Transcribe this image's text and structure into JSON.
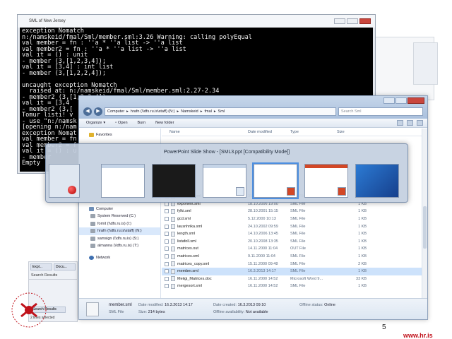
{
  "background_windows": {
    "editor_side_panel": {
      "tabs": [
        "Expl...",
        "Docu..."
      ],
      "panel_label": "Search Results",
      "bottom_tab": "Search Results",
      "status": "2 lines selected"
    }
  },
  "sml_window": {
    "title": "SML of New Jersey",
    "console_lines": [
      "exception Nomatch",
      "n:/namskeid/fmal/Sml/member.sml:3.26 Warning: calling polyEqual",
      "val member = fn : ''a * ''a list -> ''a list",
      "val member2 = fn : ''a * ''a list -> ''a list",
      "val it = () : unit",
      "- member (3,[1,2,3,4]);",
      "val it = [3,4] : int list",
      "- member (3,[1,2,2,4]);",
      "",
      "uncaught exception Nomatch",
      "  raised at: n:/namskeid/fmal/Sml/member.sml:2.27-2.34",
      "- member2 (3,[1,2,3,4]);",
      "val it = [3,4",
      "- member2 (3,[",
      "Tomur listi! v",
      "- use \"n:/namsk",
      "[opening n:/nam",
      "exception Nomat",
      "val member = fn",
      "val member2 = f",
      "val it = () : u",
      "- member",
      "Empty"
    ]
  },
  "explorer": {
    "address_path": [
      "Computer",
      "hrafn (\\\\dfs.ru.is\\staff) (N:)",
      "Namskeid",
      "fmal",
      "Sml"
    ],
    "search_placeholder": "Search Sml",
    "toolbar": {
      "organize": "Organize",
      "open": "Open",
      "burn": "Burn",
      "new_folder": "New folder"
    },
    "nav": {
      "favorites": "Favorites",
      "computer": "Computer",
      "drives": [
        "System Reserved (C:)",
        "fornit (\\\\dfs.ru.is) (I:)",
        "hrafn (\\\\dfs.ru.is\\staff) (N:)",
        "samsign (\\\\dfs.ru.is) (S:)",
        "almanna (\\\\dfs.ru.is) (T:)"
      ],
      "network": "Network"
    },
    "columns": {
      "name": "Name",
      "date": "Date modified",
      "type": "Type",
      "size": "Size"
    },
    "files": [
      {
        "name": "exception.sml",
        "date": "31.10.2001 16:55",
        "type": "SML File",
        "size": "1 KB"
      },
      {
        "name": "exponent.sml",
        "date": "18.10.2006 19:00",
        "type": "SML File",
        "size": "1 KB"
      },
      {
        "name": "fylki.sml",
        "date": "28.10.2001 15:15",
        "type": "SML File",
        "size": "1 KB"
      },
      {
        "name": "gcd.sml",
        "date": "5.12.2000 10:13",
        "type": "SML File",
        "size": "1 KB"
      },
      {
        "name": "lausnhrika.sml",
        "date": "24.10.2002 09:59",
        "type": "SML File",
        "size": "1 KB"
      },
      {
        "name": "length.sml",
        "date": "14.10.2006 13:45",
        "type": "SML File",
        "size": "1 KB"
      },
      {
        "name": "listafoll.sml",
        "date": "20.10.2008 13:35",
        "type": "SML File",
        "size": "1 KB"
      },
      {
        "name": "matrices.out",
        "date": "14.11.2000 11:04",
        "type": "OUT File",
        "size": "1 KB"
      },
      {
        "name": "matrices.sml",
        "date": "9.11.2000 11:04",
        "type": "SML File",
        "size": "1 KB"
      },
      {
        "name": "matrices_copy.sml",
        "date": "15.11.2000 09:48",
        "type": "SML File",
        "size": "2 KB"
      },
      {
        "name": "member.sml",
        "date": "16.3.2013 14:17",
        "type": "SML File",
        "size": "1 KB",
        "selected": true
      },
      {
        "name": "Meiigi_Matrices.doc",
        "date": "16.11.2000 14:52",
        "type": "Microsoft Word 9...",
        "size": "33 KB"
      },
      {
        "name": "mergesort.sml",
        "date": "16.11.2000 14:52",
        "type": "SML File",
        "size": "1 KB"
      }
    ],
    "details": {
      "name": "member.sml",
      "type": "SML File",
      "date_modified_label": "Date modified:",
      "date_modified": "16.3.2013 14:17",
      "date_created_label": "Date created:",
      "date_created": "16.3.2013 09:10",
      "size_label": "Size:",
      "size": "214 bytes",
      "offline_label": "Offline availability:",
      "offline_value": "Not available",
      "offline_status_label": "Offline status:",
      "offline_status": "Online"
    }
  },
  "switcher": {
    "title": "PowerPoint Slide Show - [SML3.ppt [Compatibility Mode]]"
  },
  "footer": {
    "slide_number": "5",
    "url": "www.hr.is"
  },
  "colors": {
    "accent_red": "#c0121b",
    "selection_blue": "#cde2fb",
    "console_bg": "#000000"
  }
}
